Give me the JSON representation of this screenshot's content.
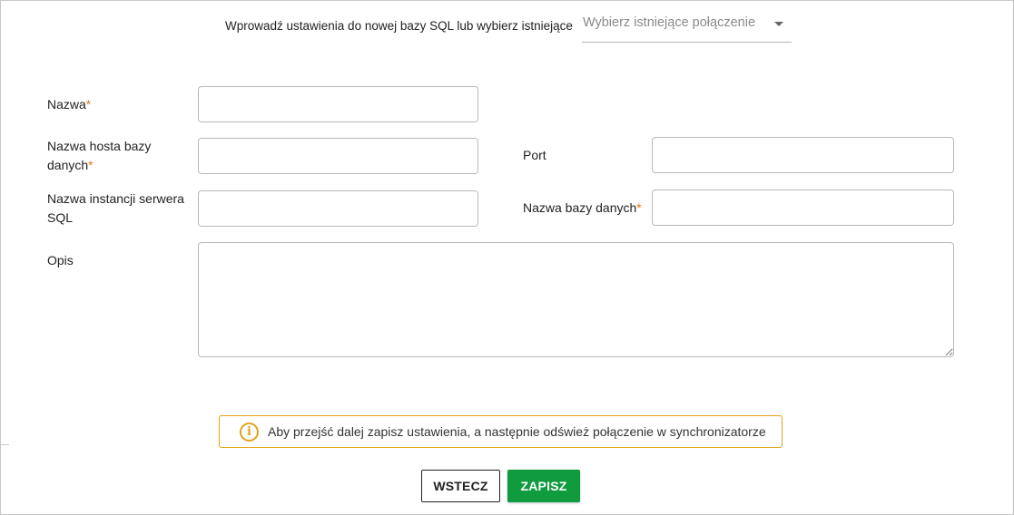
{
  "header": {
    "prompt": "Wprowadź ustawienia do nowej bazy SQL lub wybierz istniejące",
    "select_placeholder": "Wybierz istniejące połączenie"
  },
  "form": {
    "name_label": "Nazwa",
    "host_label_line1": "Nazwa hosta bazy",
    "host_label_line2": "danych",
    "port_label": "Port",
    "instance_label_line1": "Nazwa instancji serwera",
    "instance_label_line2": "SQL",
    "db_name_label": "Nazwa bazy danych",
    "description_label": "Opis",
    "required_marker": "*",
    "values": {
      "name": "",
      "host": "",
      "port": "",
      "instance": "",
      "db_name": "",
      "description": ""
    }
  },
  "notice": {
    "icon": "info-icon",
    "icon_glyph": "i",
    "text": "Aby przejść dalej zapisz ustawienia, a następnie odśwież połączenie w synchronizatorze"
  },
  "actions": {
    "back_label": "WSTECZ",
    "save_label": "ZAPISZ"
  },
  "colors": {
    "accent_green": "#0f9b3e",
    "required_orange": "#e2761c",
    "notice_border": "#e3a21a"
  }
}
